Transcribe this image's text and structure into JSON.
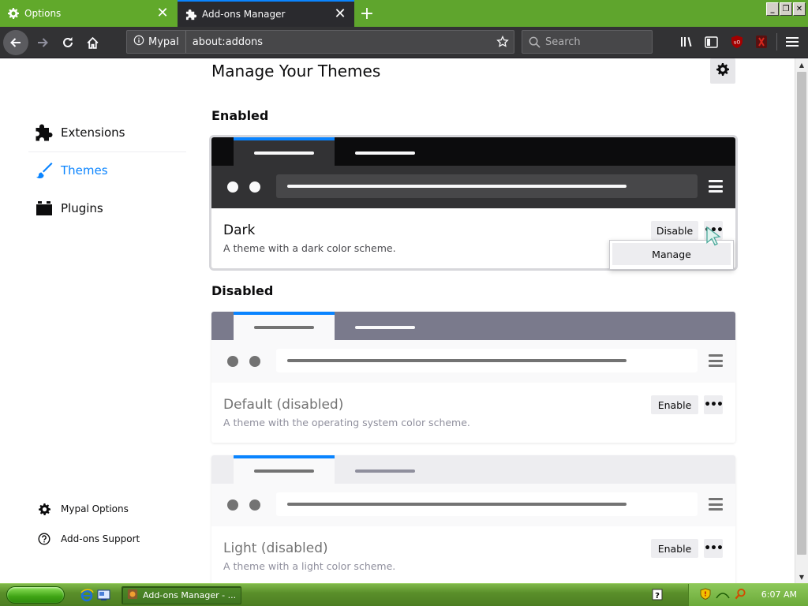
{
  "tabs": [
    {
      "label": "Options",
      "icon": "gear-icon"
    },
    {
      "label": "Add-ons Manager",
      "icon": "puzzle-icon"
    }
  ],
  "window_buttons": [
    "minimize",
    "restore",
    "close"
  ],
  "navbar": {
    "identity_label": "Mypal",
    "url": "about:addons",
    "search_placeholder": "Search"
  },
  "sidebar": {
    "categories": [
      {
        "label": "Extensions",
        "icon": "puzzle-icon",
        "selected": false
      },
      {
        "label": "Themes",
        "icon": "brush-icon",
        "selected": true
      },
      {
        "label": "Plugins",
        "icon": "plugin-block-icon",
        "selected": false
      }
    ],
    "footer": [
      {
        "label": "Mypal Options",
        "icon": "gear-icon"
      },
      {
        "label": "Add-ons Support",
        "icon": "help-circle-icon"
      }
    ]
  },
  "main": {
    "title": "Manage Your Themes",
    "enabled_heading": "Enabled",
    "disabled_heading": "Disabled",
    "themes": [
      {
        "name": "Dark",
        "description": "A theme with a dark color scheme.",
        "action": "Disable",
        "enabled": true,
        "tabbar_color": "#0c0c0d",
        "nav_color": "#323234"
      },
      {
        "name": "Default (disabled)",
        "description": "A theme with the operating system color scheme.",
        "action": "Enable",
        "enabled": false,
        "tabbar_color": "#7a7a8c",
        "nav_color": "#f9f9fa"
      },
      {
        "name": "Light (disabled)",
        "description": "A theme with a light color scheme.",
        "action": "Enable",
        "enabled": false,
        "tabbar_color": "#ededf0",
        "nav_color": "#f9f9fa"
      }
    ],
    "popup_menu": {
      "item": "Manage"
    }
  },
  "taskbar": {
    "task_label": "Add-ons Manager - ...",
    "clock": "6:07 AM"
  },
  "colors": {
    "accent": "#0a84ff",
    "tabstrip": "#5fa52d",
    "toolbar": "#323234"
  }
}
